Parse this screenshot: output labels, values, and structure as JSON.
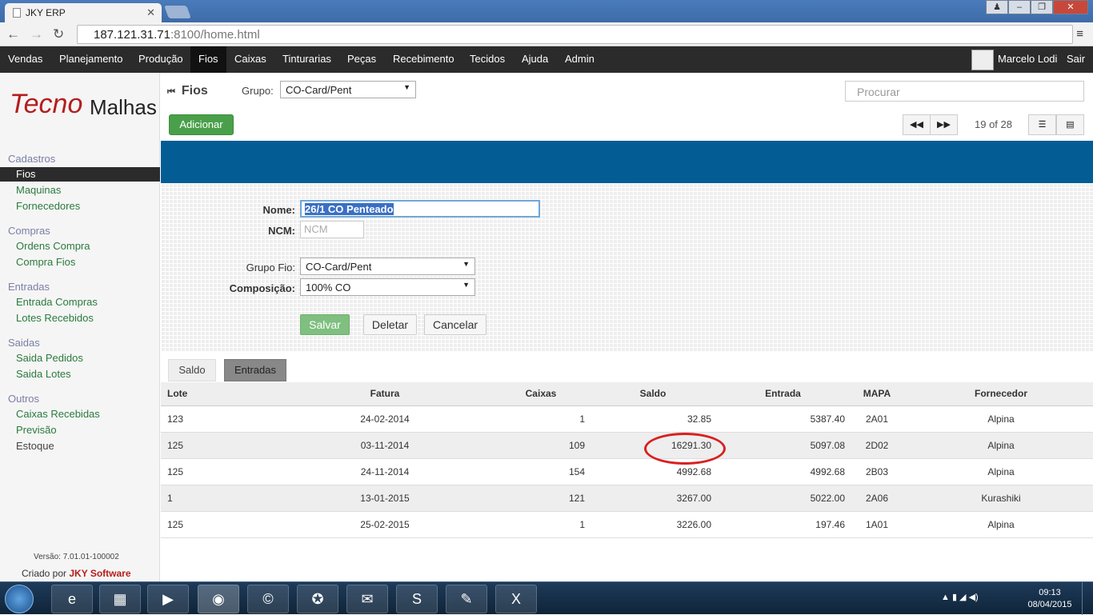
{
  "browser": {
    "tab_title": "JKY ERP",
    "url_host": "187.121.31.71",
    "url_rest": ":8100/home.html"
  },
  "nav": {
    "items": [
      "Vendas",
      "Planejamento",
      "Produção",
      "Fios",
      "Caixas",
      "Tinturarias",
      "Peças",
      "Recebimento",
      "Tecidos",
      "Ajuda",
      "Admin"
    ],
    "user": "Marcelo Lodi",
    "logout": "Sair"
  },
  "sidebar": {
    "logo_a": "Tecno",
    "logo_b": "Malhas",
    "sections": [
      {
        "title": "Cadastros",
        "items": [
          "Fios",
          "Maquinas",
          "Fornecedores"
        ]
      },
      {
        "title": "Compras",
        "items": [
          "Ordens Compra",
          "Compra Fios"
        ]
      },
      {
        "title": "Entradas",
        "items": [
          "Entrada Compras",
          "Lotes Recebidos"
        ]
      },
      {
        "title": "Saidas",
        "items": [
          "Saida Pedidos",
          "Saida Lotes"
        ]
      },
      {
        "title": "Outros",
        "items": [
          "Caixas Recebidas",
          "Previsão",
          "Estoque"
        ]
      }
    ],
    "version": "Versão: 7.01.01-100002",
    "credit_prefix": "Criado por",
    "credit_brand": "JKY Software"
  },
  "header": {
    "title": "Fios",
    "group_label": "Grupo:",
    "group_value": "CO-Card/Pent",
    "search_placeholder": "Procurar",
    "add": "Adicionar",
    "pager": "19 of 28"
  },
  "form": {
    "nome_label": "Nome:",
    "nome_value": "26/1 CO Penteado",
    "ncm_label": "NCM:",
    "ncm_placeholder": "NCM",
    "grupo_label": "Grupo Fio:",
    "grupo_value": "CO-Card/Pent",
    "comp_label": "Composição:",
    "comp_value": "100% CO",
    "save": "Salvar",
    "delete": "Deletar",
    "cancel": "Cancelar"
  },
  "tabs": {
    "saldo": "Saldo",
    "entradas": "Entradas"
  },
  "table": {
    "headers": [
      "Lote",
      "Fatura",
      "Caixas",
      "Saldo",
      "Entrada",
      "MAPA",
      "Fornecedor"
    ],
    "rows": [
      [
        "123",
        "24-02-2014",
        "1",
        "32.85",
        "5387.40",
        "2A01",
        "Alpina"
      ],
      [
        "125",
        "03-11-2014",
        "109",
        "16291.30",
        "5097.08",
        "2D02",
        "Alpina"
      ],
      [
        "125",
        "24-11-2014",
        "154",
        "4992.68",
        "4992.68",
        "2B03",
        "Alpina"
      ],
      [
        "1",
        "13-01-2015",
        "121",
        "3267.00",
        "5022.00",
        "2A06",
        "Kurashiki"
      ],
      [
        "125",
        "25-02-2015",
        "1",
        "3226.00",
        "197.46",
        "1A01",
        "Alpina"
      ]
    ]
  },
  "taskbar": {
    "time": "09:13",
    "date": "08/04/2015"
  }
}
